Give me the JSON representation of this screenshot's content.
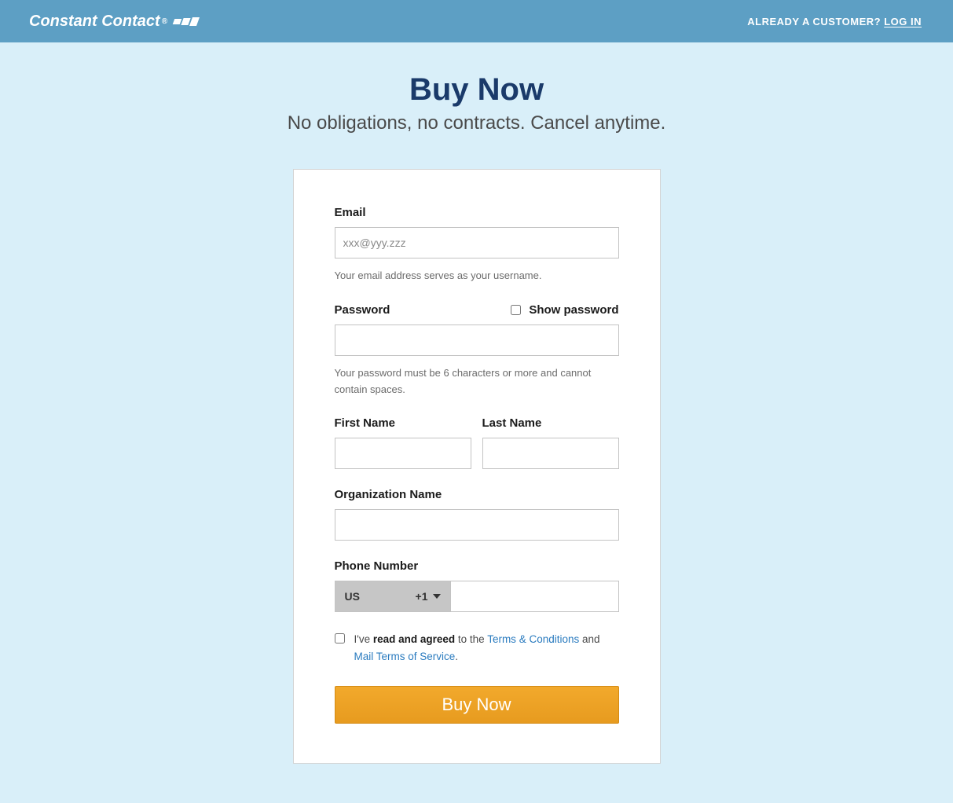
{
  "header": {
    "brand": "Constant Contact",
    "customer_prompt": "ALREADY A CUSTOMER?",
    "login_label": "LOG IN"
  },
  "hero": {
    "title": "Buy Now",
    "subtitle": "No obligations, no contracts. Cancel anytime."
  },
  "form": {
    "email": {
      "label": "Email",
      "placeholder": "xxx@yyy.zzz",
      "help": "Your email address serves as your username."
    },
    "password": {
      "label": "Password",
      "show_label": "Show password",
      "help": "Your password must be 6 characters or more and cannot contain spaces."
    },
    "first_name": {
      "label": "First Name"
    },
    "last_name": {
      "label": "Last Name"
    },
    "org": {
      "label": "Organization Name"
    },
    "phone": {
      "label": "Phone Number",
      "country": "US",
      "dial_code": "+1"
    },
    "agree": {
      "prefix": "I've ",
      "bold": "read and agreed",
      "mid": " to the ",
      "terms_link": "Terms & Conditions",
      "and": " and ",
      "mail_link": "Mail Terms of Service",
      "period": "."
    },
    "submit_label": "Buy Now"
  }
}
